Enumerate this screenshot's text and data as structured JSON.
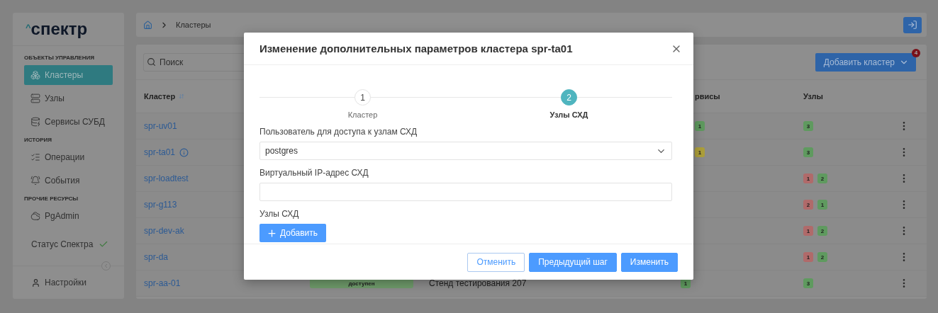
{
  "logo": {
    "mark": "^",
    "text": "спектр"
  },
  "sidebar": {
    "sections": [
      {
        "title": "ОБЪЕКТЫ УПРАВЛЕНИЯ",
        "items": [
          {
            "label": "Кластеры",
            "selected": true
          },
          {
            "label": "Узлы",
            "selected": false
          },
          {
            "label": "Сервисы СУБД",
            "selected": false
          }
        ]
      },
      {
        "title": "ИСТОРИЯ",
        "items": [
          {
            "label": "Операции",
            "selected": false
          },
          {
            "label": "События",
            "selected": false
          }
        ]
      },
      {
        "title": "ПРОЧИЕ РЕСУРСЫ",
        "items": [
          {
            "label": "PgAdmin",
            "selected": false
          }
        ]
      }
    ],
    "status": {
      "label": "Статус Спектра",
      "ok": true
    },
    "settings": "Настройки"
  },
  "breadcrumb": [
    "Кластеры"
  ],
  "search": {
    "placeholder": "Поиск"
  },
  "add_button": {
    "label": "Добавить кластер",
    "badge": "4"
  },
  "table": {
    "columns": [
      {
        "label": "Кластер"
      },
      {
        "label": "рвисы"
      },
      {
        "label": "Узлы"
      }
    ],
    "rows": [
      {
        "cluster": "spr-uv01",
        "info": false,
        "services": [
          {
            "count": "1",
            "color": "#5f9a5f"
          }
        ],
        "nodes": [
          {
            "count": "3",
            "color": "#5f9a5f"
          }
        ]
      },
      {
        "cluster": "spr-ta01",
        "info": true,
        "services": [
          {
            "count": "1",
            "color": "#ad9f3a"
          }
        ],
        "nodes": [
          {
            "count": "3",
            "color": "#5f9a5f"
          }
        ]
      },
      {
        "cluster": "spr-loadtest",
        "info": false,
        "nodes": [
          {
            "count": "1",
            "color": "#b06a6a"
          },
          {
            "count": "2",
            "color": "#5f9a5f"
          }
        ]
      },
      {
        "cluster": "spr-g113",
        "info": false,
        "nodes": [
          {
            "count": "2",
            "color": "#b06a6a"
          },
          {
            "count": "1",
            "color": "#5f9a5f"
          }
        ]
      },
      {
        "cluster": "spr-dev-ak",
        "info": false,
        "nodes": [
          {
            "count": "1",
            "color": "#b06a6a"
          },
          {
            "count": "2",
            "color": "#5f9a5f"
          }
        ]
      },
      {
        "cluster": "spr-da",
        "info": false,
        "nodes": [
          {
            "count": "1",
            "color": "#b06a6a"
          },
          {
            "count": "2",
            "color": "#5f9a5f"
          }
        ]
      },
      {
        "cluster": "spr-aa-01",
        "info": false,
        "status": "доступен",
        "description": "Стенд тестирования 207",
        "services": [
          {
            "count": "1",
            "color": "#5f9a5f"
          }
        ],
        "nodes": [
          {
            "count": "3",
            "color": "#5f9a5f"
          }
        ]
      }
    ]
  },
  "modal": {
    "title": "Изменение дополнительных параметров кластера spr-ta01",
    "steps": [
      {
        "number": "1",
        "label": "Кластер",
        "selected": false
      },
      {
        "number": "2",
        "label": "Узлы СХД",
        "selected": true
      }
    ],
    "fields": [
      {
        "label": "Пользователь для доступа к узлам СХД",
        "kind": "select",
        "value": "postgres"
      },
      {
        "label": "Виртуальный IP-адрес СХД",
        "kind": "text"
      }
    ],
    "section_label": "Узлы СХД",
    "add_label": "Добавить",
    "buttons": [
      {
        "label": "Отменить",
        "kind": "outline"
      },
      {
        "label": "Предыдущий шаг",
        "kind": "primary"
      },
      {
        "label": "Изменить",
        "kind": "primary"
      }
    ]
  }
}
